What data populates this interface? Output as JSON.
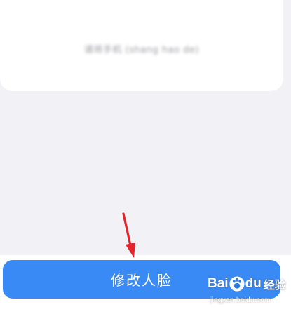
{
  "card": {
    "caption": "请将手机 (shang hao de)"
  },
  "action": {
    "modify_face_label": "修改人脸"
  },
  "watermark": {
    "brand_left": "Bai",
    "brand_right": "du",
    "product": "经验",
    "url": "jingyan.baidu.com"
  },
  "colors": {
    "background": "#f1f1f6",
    "button": "#3a8af5",
    "arrow": "#e5232b"
  },
  "icons": {
    "annotation": "arrow-down-icon",
    "watermark_mark": "paw-icon"
  }
}
